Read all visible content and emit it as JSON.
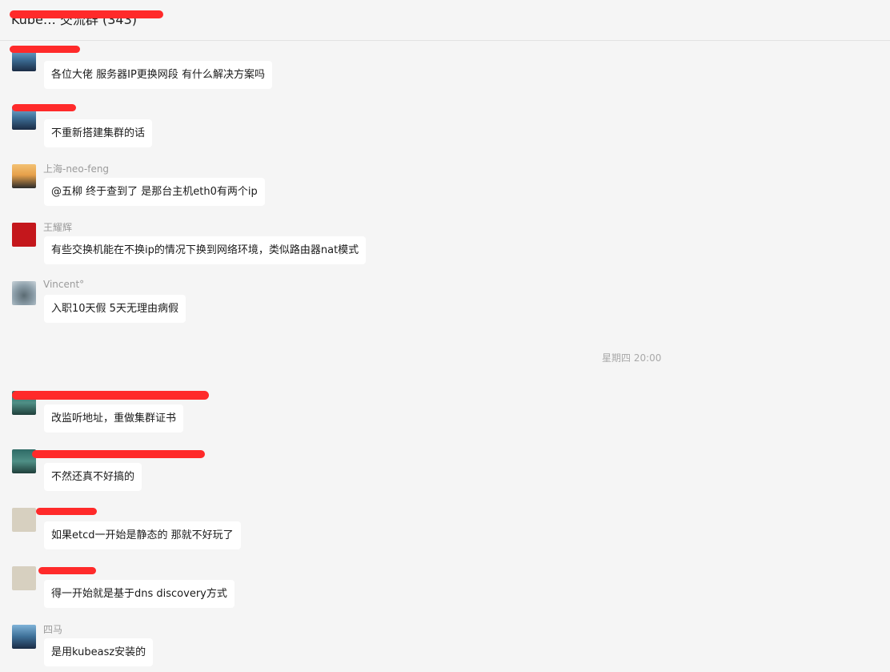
{
  "header": {
    "title": "Kube… 交流群 (343)"
  },
  "separator": {
    "time": "星期四 20:00"
  },
  "messages": [
    {
      "sender": "",
      "text": "各位大佬  服务器IP更换网段  有什么解决方案吗",
      "avatar_icon": "sea-landscape-icon"
    },
    {
      "sender": "",
      "text": "不重新搭建集群的话",
      "avatar_icon": "sea-landscape-icon"
    },
    {
      "sender": "上海-neo-feng",
      "text": "@五柳 终于查到了 是那台主机eth0有两个ip",
      "avatar_icon": "person-icon"
    },
    {
      "sender": "王耀辉",
      "text": "有些交换机能在不换ip的情况下换到网络环境，类似路由器nat模式",
      "avatar_icon": "red-portrait-icon"
    },
    {
      "sender": "Vincent°",
      "text": "入职10天假 5天无理由病假",
      "avatar_icon": "grey-sphere-icon"
    },
    {
      "sender": "",
      "text": "改监听地址，重做集群证书",
      "avatar_icon": "teal-photo-icon"
    },
    {
      "sender": "",
      "text": "不然还真不好搞的",
      "avatar_icon": "teal-photo-icon"
    },
    {
      "sender": "",
      "text": "如果etcd一开始是静态的 那就不好玩了",
      "avatar_icon": "calligraphy-icon"
    },
    {
      "sender": "",
      "text": "得一开始就是基于dns discovery方式",
      "avatar_icon": "calligraphy-icon"
    },
    {
      "sender": "四马",
      "text": "是用kubeasz安装的",
      "avatar_icon": "sea-landscape-icon"
    }
  ],
  "colors": {
    "background": "#f5f5f5",
    "bubble": "#ffffff",
    "redaction": "#ff2a2a",
    "sender_text": "#9b9b9b"
  }
}
